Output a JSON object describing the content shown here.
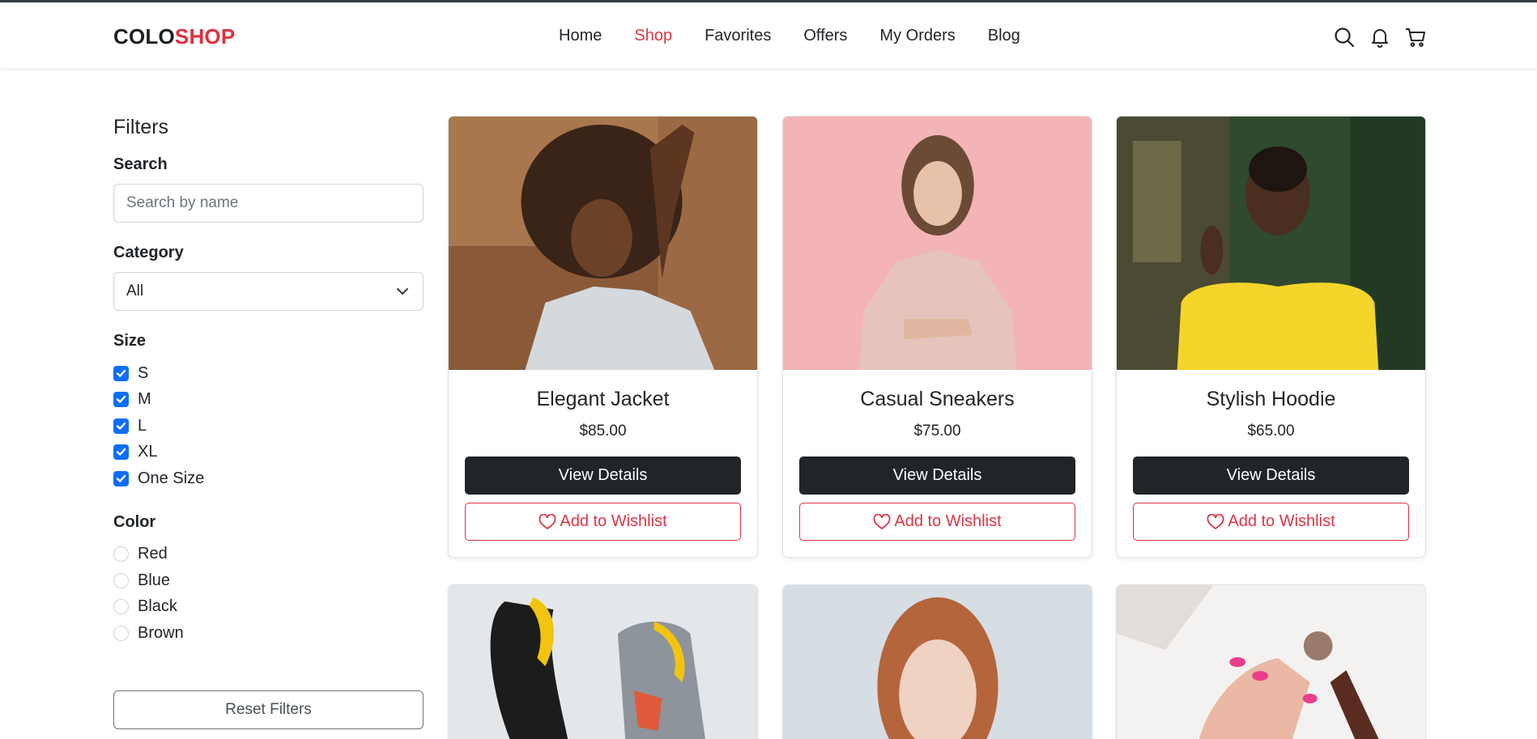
{
  "brand": {
    "part1": "COLO",
    "part2": "SHOP"
  },
  "nav": [
    "Home",
    "Shop",
    "Favorites",
    "Offers",
    "My Orders",
    "Blog"
  ],
  "header_icons": [
    "search-icon",
    "bell-icon",
    "cart-icon"
  ],
  "sidebar": {
    "title": "Filters",
    "search": {
      "label": "Search",
      "placeholder": "Search by name",
      "value": ""
    },
    "category": {
      "label": "Category",
      "selected": "All"
    },
    "size": {
      "label": "Size",
      "options": [
        "S",
        "M",
        "L",
        "XL",
        "One Size"
      ],
      "checked": [
        true,
        true,
        true,
        true,
        true
      ]
    },
    "color": {
      "label": "Color",
      "options": [
        "Red",
        "Blue",
        "Black",
        "Brown"
      ]
    },
    "reset_label": "Reset Filters"
  },
  "products": [
    {
      "name": "Elegant Jacket",
      "price": "$85.00"
    },
    {
      "name": "Casual Sneakers",
      "price": "$75.00"
    },
    {
      "name": "Stylish Hoodie",
      "price": "$65.00"
    }
  ],
  "card_buttons": {
    "details": "View Details",
    "wishlist": "Add to Wishlist"
  },
  "colors": {
    "accent": "#dc3545",
    "dark_button": "#212529",
    "checkbox": "#0d6efd"
  }
}
